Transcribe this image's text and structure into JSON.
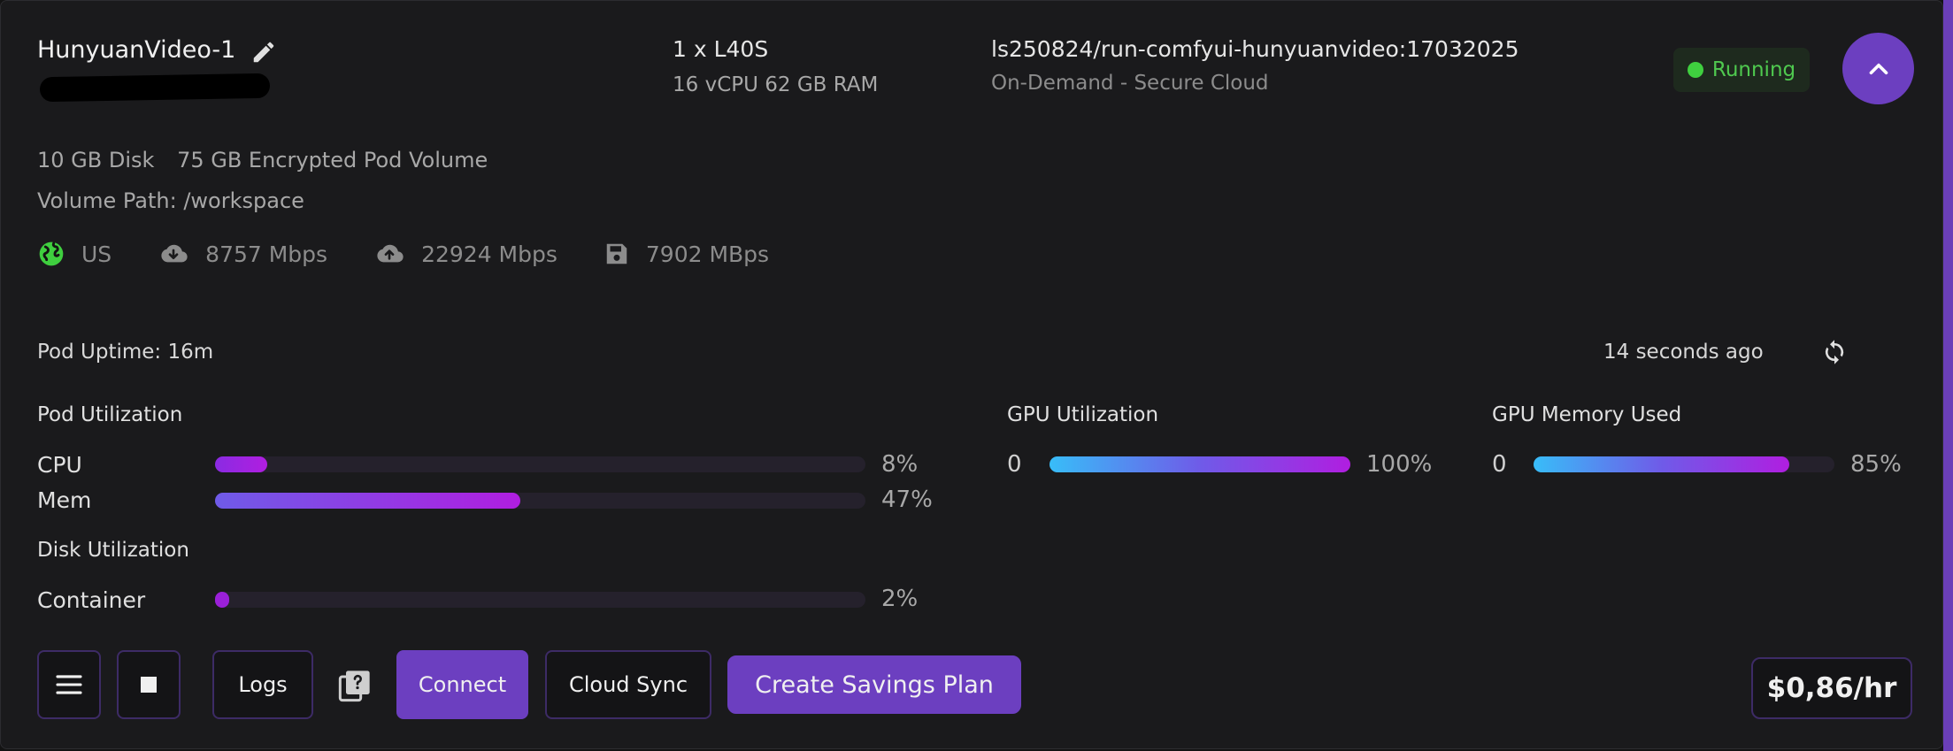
{
  "pod": {
    "name": "HunyuanVideo-1",
    "gpu": "1 x L40S",
    "specs": "16 vCPU 62 GB RAM",
    "image": "ls250824/run-comfyui-hunyuanvideo:17032025",
    "cloud": "On-Demand - Secure Cloud",
    "status": "Running",
    "status_color": "#3fcf3f",
    "disk": "10 GB Disk",
    "volume": "75 GB Encrypted Pod Volume",
    "volume_path": "Volume Path: /workspace"
  },
  "network": {
    "region": "US",
    "download": "8757 Mbps",
    "upload": "22924 Mbps",
    "disk_speed": "7902 MBps"
  },
  "uptime": {
    "label": "Pod Uptime: 16m",
    "updated": "14 seconds ago"
  },
  "utilization": {
    "pod_title": "Pod Utilization",
    "cpu_label": "CPU",
    "cpu_pct": "8%",
    "cpu_value": 8,
    "mem_label": "Mem",
    "mem_pct": "47%",
    "mem_value": 47,
    "disk_title": "Disk Utilization",
    "container_label": "Container",
    "container_pct": "2%",
    "container_value": 2,
    "gpu_title": "GPU Utilization",
    "gpu_index": "0",
    "gpu_pct": "100%",
    "gpu_value": 100,
    "gpumem_title": "GPU Memory Used",
    "gpumem_index": "0",
    "gpumem_pct": "85%",
    "gpumem_value": 85
  },
  "actions": {
    "logs": "Logs",
    "connect": "Connect",
    "cloud_sync": "Cloud Sync",
    "savings": "Create Savings Plan",
    "price": "$0,86/hr"
  },
  "colors": {
    "accent": "#6c3fc0",
    "bar_purple_start": "#8a2be2",
    "bar_purple_end": "#b01ee0",
    "bar_blue": "#38bdf8",
    "bar_indigo": "#6f5be8"
  },
  "icons": [
    "edit-icon",
    "chevron-up-icon",
    "globe-icon",
    "cloud-download-icon",
    "cloud-upload-icon",
    "save-disk-icon",
    "refresh-icon",
    "menu-icon",
    "stop-icon",
    "help-library-icon"
  ]
}
